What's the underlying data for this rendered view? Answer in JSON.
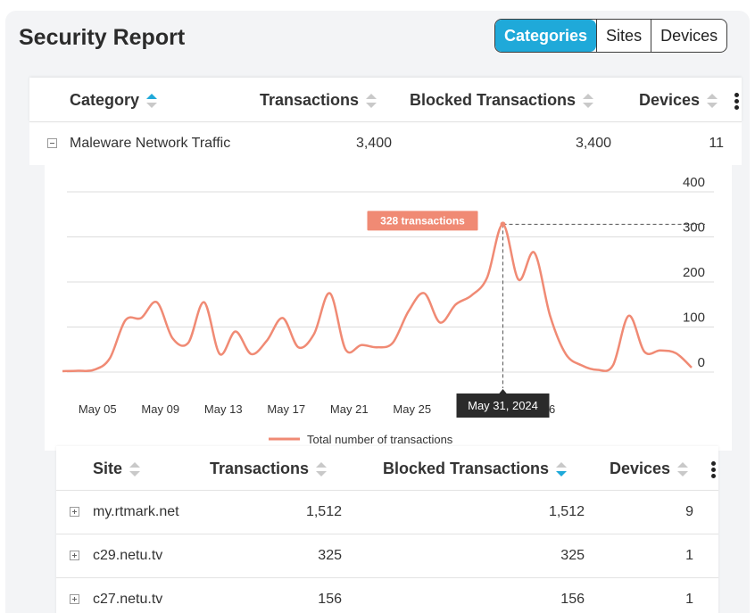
{
  "header": {
    "title": "Security Report",
    "tabs": [
      {
        "label": "Categories",
        "active": true
      },
      {
        "label": "Sites",
        "active": false
      },
      {
        "label": "Devices",
        "active": false
      }
    ]
  },
  "category_table": {
    "columns": [
      "Category",
      "Transactions",
      "Blocked Transactions",
      "Devices"
    ],
    "sort": {
      "column": "Category",
      "direction": "ascending"
    },
    "rows": [
      {
        "category": "Maleware Network Traffic",
        "transactions": "3,400",
        "blocked": "3,400",
        "devices": "11",
        "expanded": true
      }
    ]
  },
  "chart_data": {
    "type": "line",
    "series": [
      {
        "name": "Total number of transactions",
        "color": "#f08a74",
        "x": [
          "May 03",
          "May 04",
          "May 05",
          "May 06",
          "May 07",
          "May 08",
          "May 09",
          "May 10",
          "May 11",
          "May 12",
          "May 13",
          "May 14",
          "May 15",
          "May 16",
          "May 17",
          "May 18",
          "May 19",
          "May 20",
          "May 21",
          "May 22",
          "May 23",
          "May 24",
          "May 25",
          "May 26",
          "May 27",
          "May 28",
          "May 29",
          "May 30",
          "May 31",
          "Jun 01",
          "Jun 02",
          "Jun 03",
          "Jun 04",
          "Jun 05",
          "Jun 06",
          "Jun 07",
          "Jun 08",
          "Jun 09",
          "Jun 10",
          "Jun 11",
          "Jun 12"
        ],
        "values": [
          2,
          3,
          5,
          30,
          115,
          120,
          155,
          75,
          65,
          155,
          40,
          90,
          40,
          70,
          120,
          55,
          85,
          175,
          50,
          60,
          55,
          65,
          135,
          175,
          110,
          150,
          170,
          210,
          328,
          205,
          265,
          125,
          40,
          15,
          5,
          15,
          125,
          45,
          48,
          42,
          10
        ]
      }
    ],
    "xticks": [
      "May 05",
      "May 09",
      "May 13",
      "May 17",
      "May 21",
      "May 25",
      "M",
      "Jun 06"
    ],
    "yticks": [
      "0",
      "100",
      "200",
      "300",
      "400"
    ],
    "ylim": [
      0,
      400
    ],
    "grid": true,
    "legend_placement": "bottom-center",
    "highlight": {
      "x": "May 31, 2024",
      "value_label": "328 transactions"
    }
  },
  "site_table": {
    "columns": [
      "Site",
      "Transactions",
      "Blocked Transactions",
      "Devices"
    ],
    "sort": {
      "column": "Blocked Transactions",
      "direction": "descending"
    },
    "rows": [
      {
        "site": "my.rtmark.net",
        "transactions": "1,512",
        "blocked": "1,512",
        "devices": "9"
      },
      {
        "site": "c29.netu.tv",
        "transactions": "325",
        "blocked": "325",
        "devices": "1"
      },
      {
        "site": "c27.netu.tv",
        "transactions": "156",
        "blocked": "156",
        "devices": "1"
      }
    ]
  },
  "colors": {
    "accent": "#1fa9d9",
    "line": "#f08a74"
  }
}
